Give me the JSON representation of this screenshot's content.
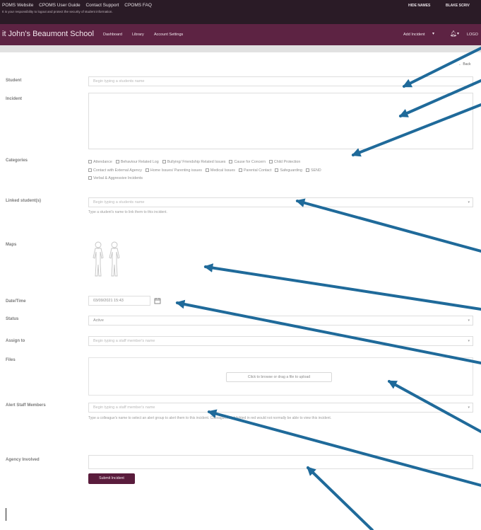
{
  "topbar": {
    "links": [
      "POMS Website",
      "CPOMS User Guide",
      "Contact Support",
      "CPOMS FAQ"
    ],
    "notice": "It is your responsibility to logout and protect the security of student information.",
    "user_left": "HIDE NAMES",
    "user_right": "BLAKE SCRIV"
  },
  "navbar": {
    "school": "it John's Beaumont School",
    "items": [
      "Dashboard",
      "Library",
      "Account Settings"
    ],
    "add_incident": "Add Incident",
    "logout": "LOGO"
  },
  "back": "← Back",
  "form": {
    "student": {
      "label": "Student",
      "placeholder": "Begin typing a students name"
    },
    "incident": {
      "label": "Incident"
    },
    "categories": {
      "label": "Categories",
      "items": [
        "Attendance",
        "Behaviour Related Log",
        "Bullying/ Friendship Related Issues",
        "Cause for Concern",
        "Child Protection",
        "Contact with External Agency",
        "Home Issues/ Parenting issues",
        "Medical Issues",
        "Parental Contact",
        "Safeguarding",
        "SEND",
        "Verbal & Aggressive Incidents"
      ]
    },
    "linked": {
      "label": "Linked student(s)",
      "placeholder": "Begin typing a students name",
      "help": "Type a student's name to link them to this incident."
    },
    "maps": {
      "label": "Maps"
    },
    "datetime": {
      "label": "Date/Time",
      "value": "03/09/2021 15:43"
    },
    "status": {
      "label": "Status",
      "value": "Active"
    },
    "assign": {
      "label": "Assign to",
      "placeholder": "Begin typing a staff member's name"
    },
    "files": {
      "label": "Files",
      "button": "Click to browse or drag a file to upload"
    },
    "alert": {
      "label": "Alert Staff Members",
      "placeholder": "Begin typing a staff member's name",
      "help": "Type a colleague's name to select an alert group to alert them to this incident. Colleagues highlighted in red would not normally be able to view this incident."
    },
    "agency": {
      "label": "Agency Involved"
    },
    "submit": "Submit Incident"
  },
  "colors": {
    "topbar": "#2a1b26",
    "navbar": "#5d2343",
    "submit": "#5a1c3c",
    "annotation_arrow": "#1f6a9a"
  }
}
